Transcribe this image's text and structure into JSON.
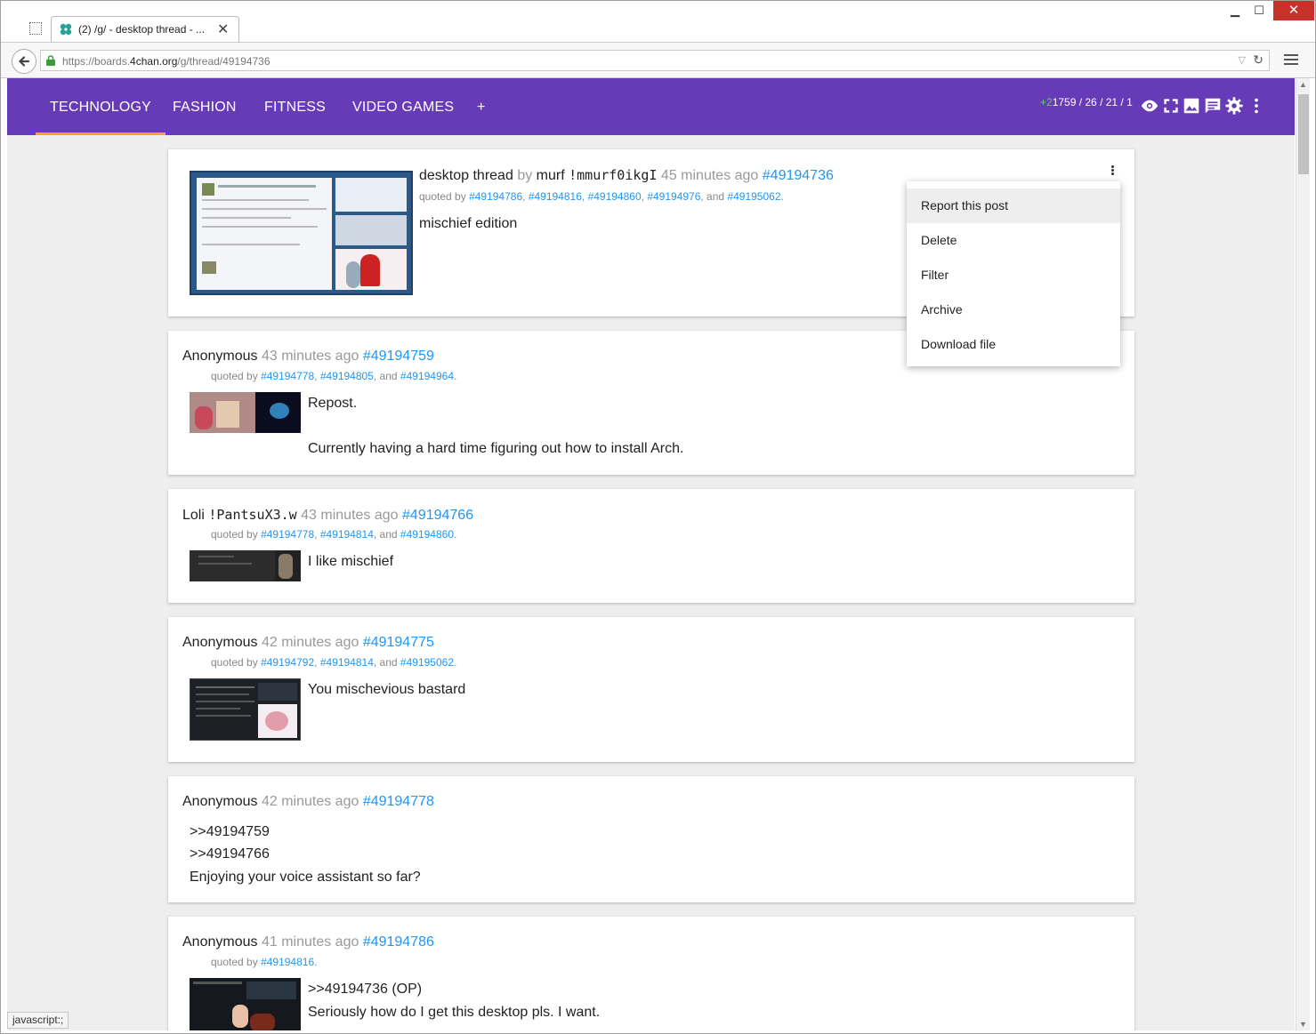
{
  "browser": {
    "tab_title": "(2) /g/ - desktop thread - ...",
    "url_prefix": "https://boards.",
    "url_domain": "4chan.org",
    "url_path": "/g/thread/49194736",
    "status_text": "javascript:;"
  },
  "nav": {
    "tabs": [
      {
        "label": "TECHNOLOGY",
        "active": true
      },
      {
        "label": "FASHION",
        "active": false
      },
      {
        "label": "FITNESS",
        "active": false
      },
      {
        "label": "VIDEO GAMES",
        "active": false
      }
    ],
    "add_label": "+",
    "stats_new": "+2",
    "stats_rest": "1759 / 26 / 21 / 1",
    "accent": "#673ab7",
    "tab_indicator": "#ff9f2f"
  },
  "posts": [
    {
      "subject": "desktop thread",
      "by": "by",
      "name": "murf",
      "trip": "!mmurf0ikgI",
      "time": "45 minutes ago",
      "id": "#49194736",
      "quoted_prefix": "quoted by",
      "quoted": [
        "#49194786",
        "#49194816",
        "#49194860",
        "#49194976",
        "#49195062"
      ],
      "body": [
        "mischief edition"
      ]
    },
    {
      "name": "Anonymous",
      "time": "43 minutes ago",
      "id": "#49194759",
      "quoted_prefix": "quoted by",
      "quoted": [
        "#49194778",
        "#49194805",
        "#49194964"
      ],
      "body": [
        "Repost.",
        "Currently having a hard time figuring out how to install Arch."
      ]
    },
    {
      "name": "Loli",
      "trip": "!PantsuX3.w",
      "time": "43 minutes ago",
      "id": "#49194766",
      "quoted_prefix": "quoted by",
      "quoted": [
        "#49194778",
        "#49194814",
        "#49194860"
      ],
      "body": [
        "I like mischief"
      ]
    },
    {
      "name": "Anonymous",
      "time": "42 minutes ago",
      "id": "#49194775",
      "quoted_prefix": "quoted by",
      "quoted": [
        "#49194792",
        "#49194814",
        "#49195062"
      ],
      "body": [
        "You mischevious bastard"
      ]
    },
    {
      "name": "Anonymous",
      "time": "42 minutes ago",
      "id": "#49194778",
      "replies": [
        ">>49194759",
        ">>49194766"
      ],
      "body": [
        "Enjoying your voice assistant so far?"
      ]
    },
    {
      "name": "Anonymous",
      "time": "41 minutes ago",
      "id": "#49194786",
      "quoted_prefix": "quoted by",
      "quoted": [
        "#49194816"
      ],
      "replies": [
        ">>49194736 (OP)"
      ],
      "body": [
        "Seriously how do I get this desktop pls. I want."
      ]
    }
  ],
  "context_menu": {
    "items": [
      "Report this post",
      "Delete",
      "Filter",
      "Archive",
      "Download file"
    ]
  },
  "icons": [
    "eye-icon",
    "fullscreen-icon",
    "image-icon",
    "chat-icon",
    "gear-icon",
    "more-vert-icon"
  ]
}
